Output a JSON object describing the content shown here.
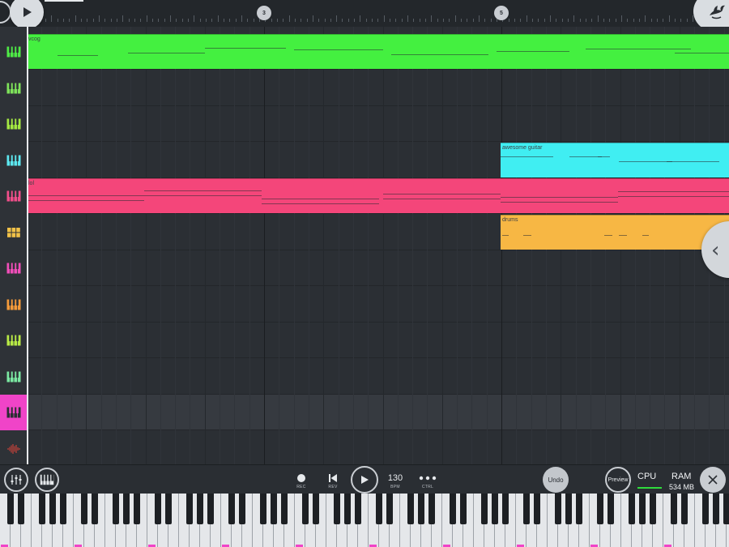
{
  "timeline": {
    "bar_markers": [
      "3",
      "5"
    ],
    "play_icon": "play-icon",
    "logo_icon": "fl-studio-logo-icon"
  },
  "tracks": {
    "icons": [
      {
        "icon": "piano-icon",
        "color": "#4eea46"
      },
      {
        "icon": "piano-icon",
        "color": "#7ee35a"
      },
      {
        "icon": "piano-icon",
        "color": "#a4e842"
      },
      {
        "icon": "piano-icon",
        "color": "#5de8f0"
      },
      {
        "icon": "piano-icon",
        "color": "#f04e8a"
      },
      {
        "icon": "drum-pads-icon",
        "color": "#f0c148"
      },
      {
        "icon": "piano-icon",
        "color": "#f04eb8"
      },
      {
        "icon": "piano-icon",
        "color": "#f49a3a"
      },
      {
        "icon": "piano-icon",
        "color": "#b8ea46"
      },
      {
        "icon": "piano-icon",
        "color": "#7be8a2"
      },
      {
        "icon": "piano-icon",
        "color": "#2a2e33"
      },
      {
        "icon": "audio-wave-icon",
        "color": "#e0443a"
      }
    ],
    "selected_index": 10
  },
  "clips": [
    {
      "name": "vcog",
      "color": "#44f040",
      "track": 0
    },
    {
      "name": "awesome guitar",
      "color": "#40eef2",
      "track": 3
    },
    {
      "name": "lol",
      "color": "#f4467a",
      "track": 4
    },
    {
      "name": "drums",
      "color": "#f7b744",
      "track": 5
    }
  ],
  "controls": {
    "rec_label": "REC",
    "rev_label": "REV",
    "bpm_value": "130",
    "bpm_label": "BPM",
    "ctrl_label": "CTRL",
    "undo_label": "Undo",
    "preview_label": "Preview",
    "cpu_label": "CPU",
    "ram_label": "RAM",
    "ram_value": "534 MB"
  },
  "keyboard": {
    "octave_marker_color": "#f044c8"
  },
  "colors": {
    "accent": "#f044c8",
    "background": "#2b2f34"
  }
}
